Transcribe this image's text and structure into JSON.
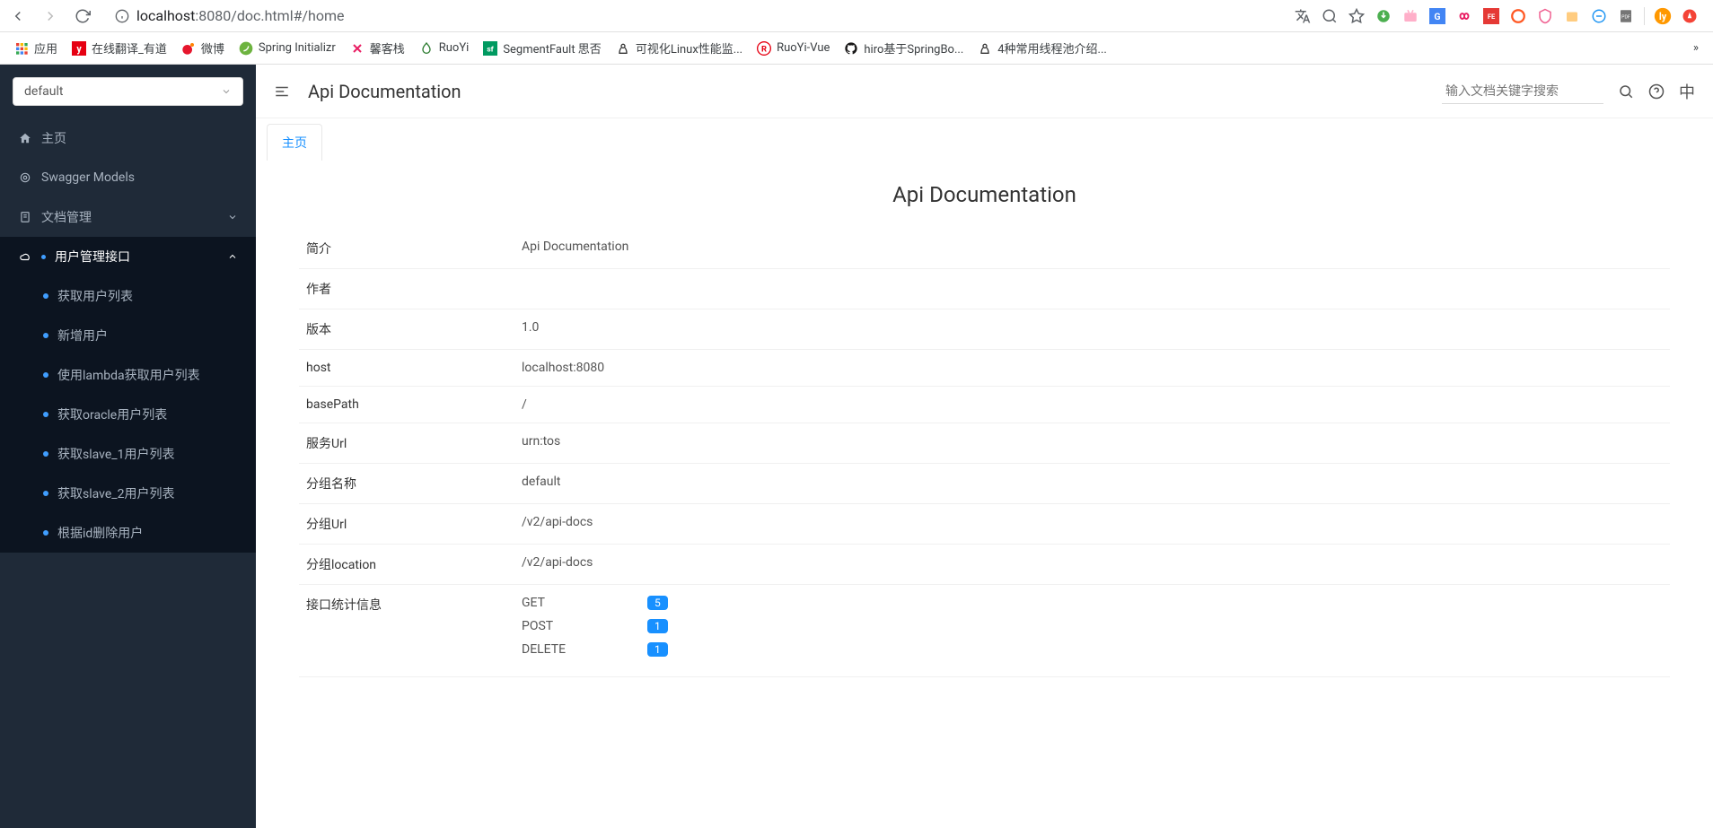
{
  "browser": {
    "url_host": "localhost",
    "url_port_path": ":8080/doc.html#/home",
    "bookmarks": [
      {
        "label": "应用"
      },
      {
        "label": "在线翻译_有道"
      },
      {
        "label": "微博"
      },
      {
        "label": "Spring Initializr"
      },
      {
        "label": "馨客栈"
      },
      {
        "label": "RuoYi"
      },
      {
        "label": "SegmentFault 思否"
      },
      {
        "label": "可视化Linux性能监..."
      },
      {
        "label": "RuoYi-Vue"
      },
      {
        "label": "hiro基于SpringBo..."
      },
      {
        "label": "4种常用线程池介绍..."
      }
    ]
  },
  "sidebar": {
    "select_value": "default",
    "items": [
      {
        "label": "主页",
        "icon": "home"
      },
      {
        "label": "Swagger Models",
        "icon": "swagger"
      },
      {
        "label": "文档管理",
        "icon": "doc",
        "expandable": true
      },
      {
        "label": "用户管理接口",
        "icon": "cloud",
        "expandable": true,
        "active": true,
        "has_dot": true
      }
    ],
    "submenu": [
      {
        "label": "获取用户列表"
      },
      {
        "label": "新增用户"
      },
      {
        "label": "使用lambda获取用户列表"
      },
      {
        "label": "获取oracle用户列表"
      },
      {
        "label": "获取slave_1用户列表"
      },
      {
        "label": "获取slave_2用户列表"
      },
      {
        "label": "根据id删除用户"
      }
    ]
  },
  "topbar": {
    "title": "Api Documentation",
    "search_placeholder": "输入文档关键字搜索",
    "lang": "中"
  },
  "tab": {
    "label": "主页"
  },
  "doc": {
    "title": "Api Documentation",
    "rows": [
      {
        "key": "简介",
        "value": "Api Documentation"
      },
      {
        "key": "作者",
        "value": ""
      },
      {
        "key": "版本",
        "value": "1.0"
      },
      {
        "key": "host",
        "value": "localhost:8080"
      },
      {
        "key": "basePath",
        "value": "/"
      },
      {
        "key": "服务Url",
        "value": "urn:tos"
      },
      {
        "key": "分组名称",
        "value": "default"
      },
      {
        "key": "分组Url",
        "value": "/v2/api-docs"
      },
      {
        "key": "分组location",
        "value": "/v2/api-docs"
      }
    ],
    "stats_label": "接口统计信息",
    "stats": [
      {
        "method": "GET",
        "count": "5"
      },
      {
        "method": "POST",
        "count": "1"
      },
      {
        "method": "DELETE",
        "count": "1"
      }
    ]
  }
}
